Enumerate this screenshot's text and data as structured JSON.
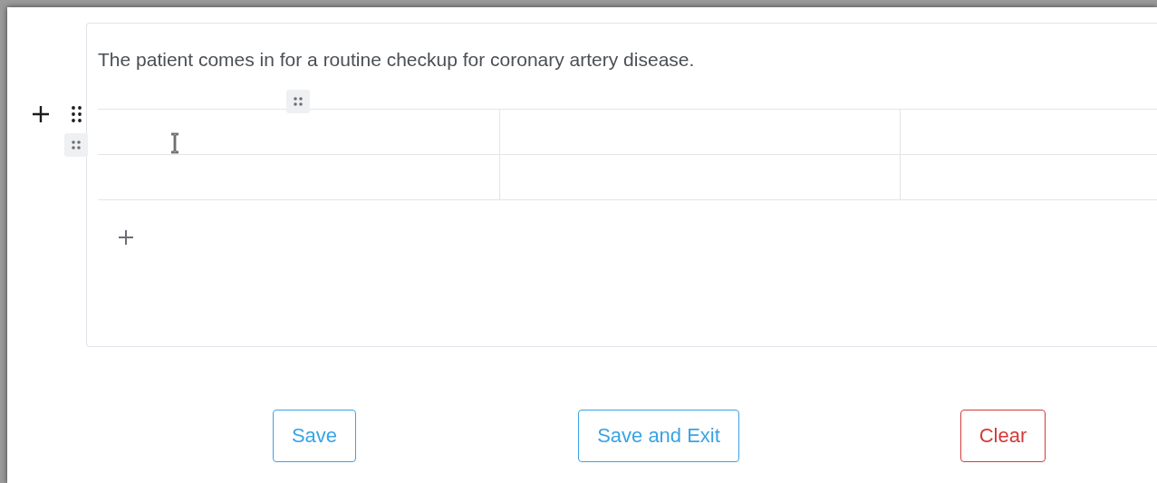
{
  "editor": {
    "paragraph": "The patient comes in for a routine checkup for coronary artery disease."
  },
  "buttons": [
    {
      "label": "Save",
      "kind": "primary"
    },
    {
      "label": "Save and Exit",
      "kind": "primary"
    },
    {
      "label": "Clear",
      "kind": "danger"
    }
  ]
}
